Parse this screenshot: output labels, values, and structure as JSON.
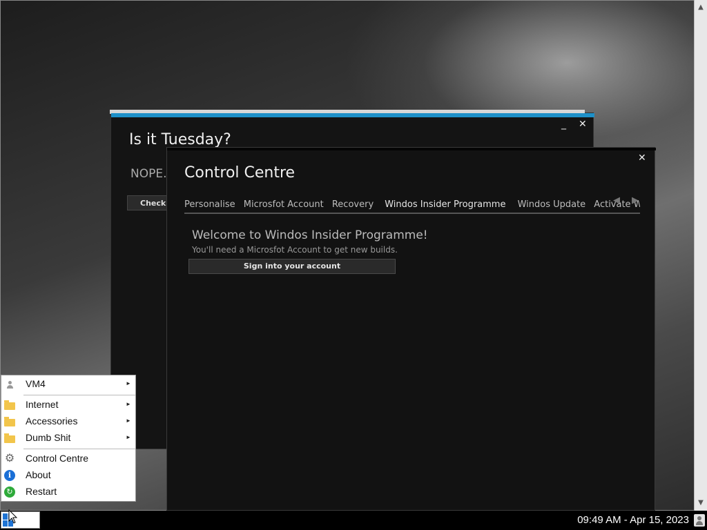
{
  "desktop": {
    "scrollbar": {
      "up": "▲",
      "down": "▼"
    }
  },
  "tuesday_window": {
    "title": "Is it Tuesday?",
    "answer": "NOPE.",
    "check_button": "Check a",
    "minimize": "_",
    "close": "✕"
  },
  "control_centre": {
    "title": "Control Centre",
    "close": "✕",
    "tabs": [
      {
        "label": "Personalise"
      },
      {
        "label": "Microsfot Account"
      },
      {
        "label": "Recovery"
      },
      {
        "label": "Windos Insider Programme",
        "active": true
      },
      {
        "label": "Windos Update"
      },
      {
        "label": "Activate Winc"
      }
    ],
    "tab_scroll_left": "◀",
    "tab_scroll_right": "▶",
    "content": {
      "heading": "Welcome to Windos Insider Programme!",
      "subtext": "You'll need a Microsfot Account to get new builds.",
      "sign_in_button": "Sign into your account"
    }
  },
  "start_menu": {
    "items": [
      {
        "label": "VM4",
        "icon": "user-icon",
        "submenu": true
      },
      {
        "label": "Internet",
        "icon": "folder-icon",
        "submenu": true
      },
      {
        "label": "Accessories",
        "icon": "folder-icon",
        "submenu": true
      },
      {
        "label": "Dumb Shit",
        "icon": "folder-icon",
        "submenu": true
      },
      {
        "label": "Control Centre",
        "icon": "gear-icon",
        "submenu": false
      },
      {
        "label": "About",
        "icon": "info-icon",
        "submenu": false
      },
      {
        "label": "Restart",
        "icon": "restart-icon",
        "submenu": false
      }
    ],
    "submenu_arrow": "►",
    "glyphs": {
      "gear": "⚙",
      "info": "i",
      "restart": "↻"
    }
  },
  "taskbar": {
    "clock": "09:49 AM - Apr 15, 2023"
  },
  "colors": {
    "accent": "#1e90c8",
    "window_bg": "#121212",
    "folder": "#f2c54b",
    "info": "#1a6fd6",
    "restart": "#2eaa3a"
  }
}
